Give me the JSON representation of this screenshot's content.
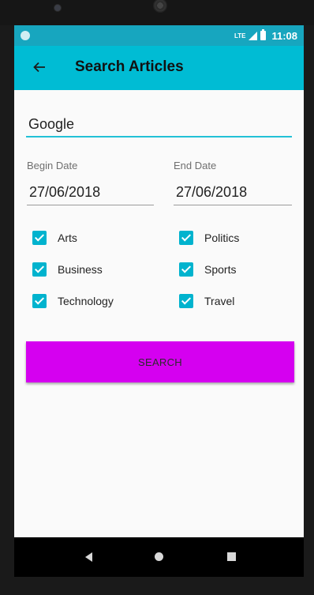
{
  "status_bar": {
    "network": "LTE",
    "time": "11:08"
  },
  "app_bar": {
    "title": "Search Articles",
    "back_icon": "arrow-left-icon"
  },
  "form": {
    "query_value": "Google",
    "begin_date_label": "Begin Date",
    "begin_date_value": "27/06/2018",
    "end_date_label": "End Date",
    "end_date_value": "27/06/2018",
    "categories": [
      {
        "label": "Arts",
        "checked": true
      },
      {
        "label": "Politics",
        "checked": true
      },
      {
        "label": "Business",
        "checked": true
      },
      {
        "label": "Sports",
        "checked": true
      },
      {
        "label": "Technology",
        "checked": true
      },
      {
        "label": "Travel",
        "checked": true
      }
    ],
    "search_label": "SEARCH"
  },
  "colors": {
    "status_bar": "#17a6bf",
    "app_bar": "#00bcd4",
    "checkbox": "#00b3ce",
    "search_button": "#d500f0"
  },
  "nav_bar": {
    "icons": [
      "back-triangle-icon",
      "home-circle-icon",
      "recents-square-icon"
    ]
  }
}
